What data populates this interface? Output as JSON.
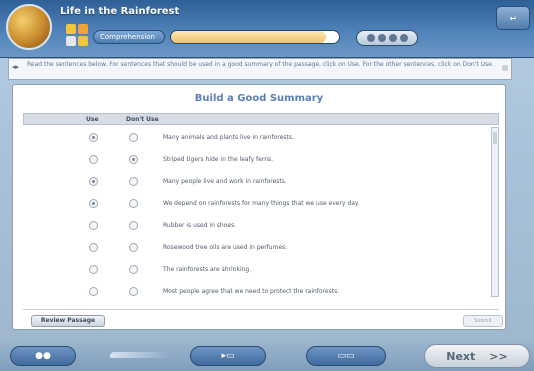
{
  "header": {
    "app_title": "Life in the Rainforest",
    "section": "Comprehension",
    "progress_fraction": 0.92
  },
  "instructions": {
    "text": "Read the sentences below. For sentences that should be used in a good summary of the passage, click on Use. For the other sentences, click on Don't Use."
  },
  "panel": {
    "title": "Build a Good Summary",
    "col_use": "Use",
    "col_dont_use": "Don't Use",
    "rows": [
      {
        "text": "Many animals and plants live in rainforests.",
        "selected": "use"
      },
      {
        "text": "Striped tigers hide in the leafy ferns.",
        "selected": "dont"
      },
      {
        "text": "Many people live and work in rainforests.",
        "selected": "use"
      },
      {
        "text": "We depend on rainforests for many things that we use every day.",
        "selected": "use"
      },
      {
        "text": "Rubber is used in shoes.",
        "selected": "none"
      },
      {
        "text": "Rosewood tree oils are used in perfumes.",
        "selected": "none"
      },
      {
        "text": "The rainforests are shrinking.",
        "selected": "none"
      },
      {
        "text": "Most people agree that we need to protect the rainforests.",
        "selected": "none"
      }
    ],
    "review_label": "Review Passage",
    "submit_label": "Submit"
  },
  "footer": {
    "next_label": "Next",
    "next_arrows": ">>"
  },
  "icons": [
    "app-logo-icon",
    "activity-grid-icon",
    "exit-icon",
    "scroll-arrows-icon",
    "glossary-icon",
    "tool-icon",
    "audio-icon"
  ]
}
